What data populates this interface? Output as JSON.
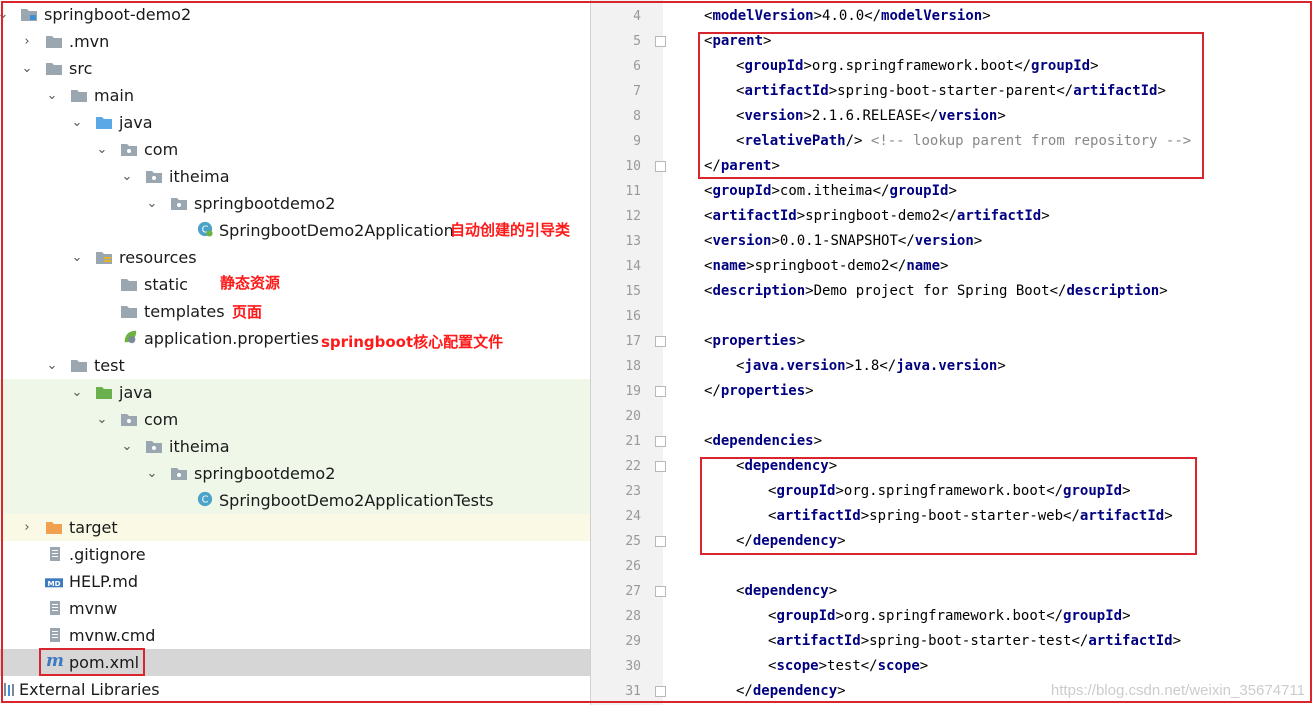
{
  "colors": {
    "accent_red": "#d9262e",
    "tag": "#000080",
    "test_bg": "#eef7e8",
    "target_bg": "#f9f9e5"
  },
  "tree": {
    "project": "springboot-demo2",
    "mvn": ".mvn",
    "src": "src",
    "main": "main",
    "main_java": "java",
    "main_com": "com",
    "main_itheima": "itheima",
    "main_pkg": "springbootdemo2",
    "app_class": "SpringbootDemo2Application",
    "resources": "resources",
    "static": "static",
    "templates": "templates",
    "app_props": "application.properties",
    "test": "test",
    "test_java": "java",
    "test_com": "com",
    "test_itheima": "itheima",
    "test_pkg": "springbootdemo2",
    "test_class": "SpringbootDemo2ApplicationTests",
    "target": "target",
    "gitignore": ".gitignore",
    "help": "HELP.md",
    "mvnw": "mvnw",
    "mvnw_cmd": "mvnw.cmd",
    "pom": "pom.xml",
    "external": "External Libraries",
    "md_badge": "MD"
  },
  "annotations": {
    "bootstrap": "自动创建的引导类",
    "static": "静态资源",
    "templates": "页面",
    "config": "springboot核心配置文件"
  },
  "editor": {
    "line_numbers": [
      "4",
      "5",
      "6",
      "7",
      "8",
      "9",
      "10",
      "11",
      "12",
      "13",
      "14",
      "15",
      "16",
      "17",
      "18",
      "19",
      "20",
      "21",
      "22",
      "23",
      "24",
      "25",
      "26",
      "27",
      "28",
      "29",
      "30",
      "31"
    ],
    "lines": {
      "l4": {
        "tag": "modelVersion",
        "text": "4.0.0"
      },
      "l5": {
        "tag": "parent"
      },
      "l6": {
        "tag": "groupId",
        "text": "org.springframework.boot"
      },
      "l7": {
        "tag": "artifactId",
        "text": "spring-boot-starter-parent"
      },
      "l8": {
        "tag": "version",
        "text": "2.1.6.RELEASE"
      },
      "l9": {
        "tag": "relativePath",
        "comment": "<!-- lookup parent from repository -->"
      },
      "l10": {
        "tag": "parent"
      },
      "l11": {
        "tag": "groupId",
        "text": "com.itheima"
      },
      "l12": {
        "tag": "artifactId",
        "text": "springboot-demo2"
      },
      "l13": {
        "tag": "version",
        "text": "0.0.1-SNAPSHOT"
      },
      "l14": {
        "tag": "name",
        "text": "springboot-demo2"
      },
      "l15": {
        "tag": "description",
        "text": "Demo project for Spring Boot"
      },
      "l17": {
        "tag": "properties"
      },
      "l18": {
        "tag": "java.version",
        "text": "1.8"
      },
      "l19": {
        "tag": "properties"
      },
      "l21": {
        "tag": "dependencies"
      },
      "l22": {
        "tag": "dependency"
      },
      "l23": {
        "tag": "groupId",
        "text": "org.springframework.boot"
      },
      "l24": {
        "tag": "artifactId",
        "text": "spring-boot-starter-web"
      },
      "l25": {
        "tag": "dependency"
      },
      "l27": {
        "tag": "dependency"
      },
      "l28": {
        "tag": "groupId",
        "text": "org.springframework.boot"
      },
      "l29": {
        "tag": "artifactId",
        "text": "spring-boot-starter-test"
      },
      "l30": {
        "tag": "scope",
        "text": "test"
      },
      "l31": {
        "tag": "dependency"
      }
    }
  },
  "watermark": "https://blog.csdn.net/weixin_35674711"
}
